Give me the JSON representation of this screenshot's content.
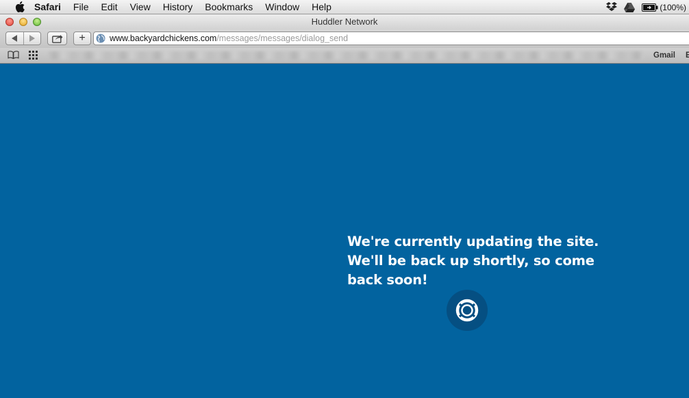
{
  "menubar": {
    "apple_icon": "apple-icon",
    "app_name": "Safari",
    "items": [
      "File",
      "Edit",
      "View",
      "History",
      "Bookmarks",
      "Window",
      "Help"
    ],
    "battery_text": "(100%)"
  },
  "window": {
    "title": "Huddler Network"
  },
  "toolbar": {
    "add_label": "+",
    "address": {
      "host": "www.backyardchickens.com",
      "path": "/messages/messages/dialog_send"
    }
  },
  "bookmarks": {
    "gmail_label": "Gmail",
    "overflow_label": "E"
  },
  "page": {
    "message_lines": [
      "We're currently updating the site.",
      "We'll be back up shortly, so come",
      "back soon!"
    ],
    "logo_icon": "huddler-logo-icon"
  },
  "colors": {
    "page_background": "#02639f",
    "logo_circle": "#054f82",
    "text": "#ffffff"
  }
}
